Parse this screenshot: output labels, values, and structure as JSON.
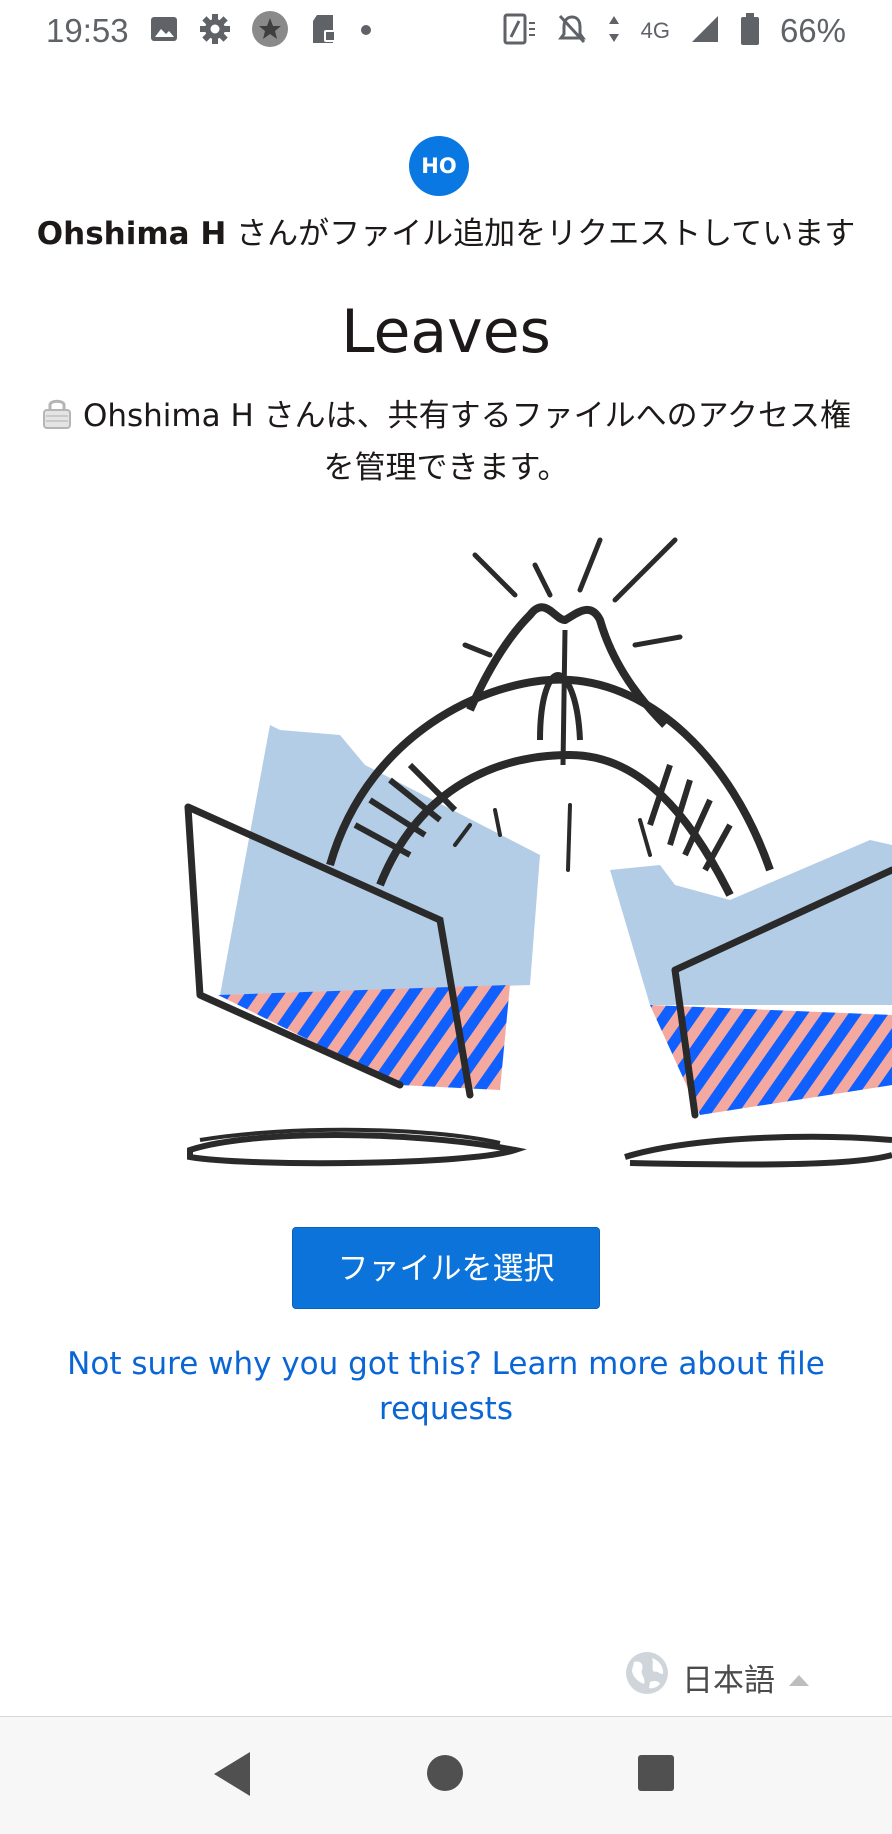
{
  "status_bar": {
    "time": "19:53",
    "left_icons": [
      "image-icon",
      "gear-icon",
      "star-circle-icon",
      "sd-card-icon",
      "dot-icon"
    ],
    "network": "4G",
    "battery": "66%",
    "right_icons": [
      "nfc-icon",
      "bell-off-icon",
      "data-arrows-icon",
      "signal-icon",
      "battery-icon"
    ]
  },
  "request": {
    "avatar_initials": "HO",
    "requester_name": "Ohshima H",
    "request_text": " さんがファイル追加をリクエストしています"
  },
  "folder": {
    "title": "Leaves",
    "access_note": "Ohshima H さんは、共有するファイルへのアクセス権を管理できます。"
  },
  "actions": {
    "choose_file_label": "ファイルを選択",
    "learn_more_link": "Not sure why you got this? Learn more about file requests"
  },
  "language": {
    "current": "日本語"
  },
  "colors": {
    "primary_blue": "#0b73da",
    "link_blue": "#0a66d4",
    "folder_blue": "#b3cde6",
    "pattern_blue": "#1060ff",
    "pattern_pink": "#f4a9a0"
  },
  "nav_bar": {
    "buttons": [
      "back-icon",
      "home-icon",
      "recents-icon"
    ]
  }
}
